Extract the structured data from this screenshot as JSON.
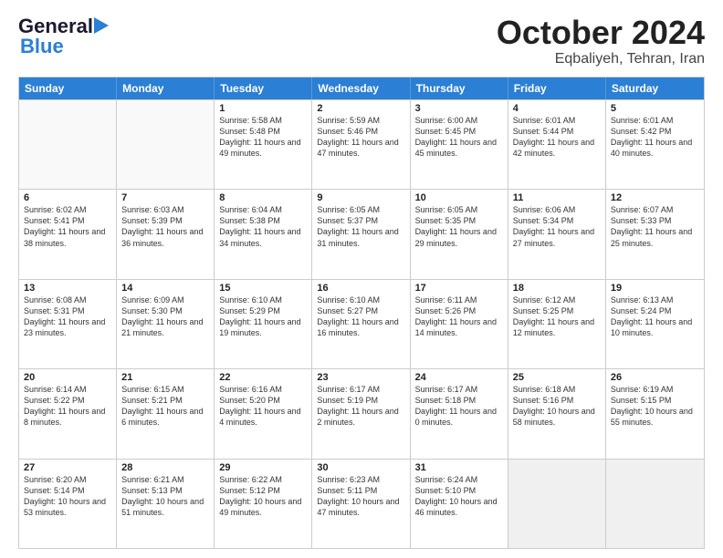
{
  "logo": {
    "general": "General",
    "blue": "Blue"
  },
  "header": {
    "month": "October 2024",
    "location": "Eqbaliyeh, Tehran, Iran"
  },
  "weekdays": [
    "Sunday",
    "Monday",
    "Tuesday",
    "Wednesday",
    "Thursday",
    "Friday",
    "Saturday"
  ],
  "rows": [
    [
      {
        "day": "",
        "info": ""
      },
      {
        "day": "",
        "info": ""
      },
      {
        "day": "1",
        "info": "Sunrise: 5:58 AM\nSunset: 5:48 PM\nDaylight: 11 hours and 49 minutes."
      },
      {
        "day": "2",
        "info": "Sunrise: 5:59 AM\nSunset: 5:46 PM\nDaylight: 11 hours and 47 minutes."
      },
      {
        "day": "3",
        "info": "Sunrise: 6:00 AM\nSunset: 5:45 PM\nDaylight: 11 hours and 45 minutes."
      },
      {
        "day": "4",
        "info": "Sunrise: 6:01 AM\nSunset: 5:44 PM\nDaylight: 11 hours and 42 minutes."
      },
      {
        "day": "5",
        "info": "Sunrise: 6:01 AM\nSunset: 5:42 PM\nDaylight: 11 hours and 40 minutes."
      }
    ],
    [
      {
        "day": "6",
        "info": "Sunrise: 6:02 AM\nSunset: 5:41 PM\nDaylight: 11 hours and 38 minutes."
      },
      {
        "day": "7",
        "info": "Sunrise: 6:03 AM\nSunset: 5:39 PM\nDaylight: 11 hours and 36 minutes."
      },
      {
        "day": "8",
        "info": "Sunrise: 6:04 AM\nSunset: 5:38 PM\nDaylight: 11 hours and 34 minutes."
      },
      {
        "day": "9",
        "info": "Sunrise: 6:05 AM\nSunset: 5:37 PM\nDaylight: 11 hours and 31 minutes."
      },
      {
        "day": "10",
        "info": "Sunrise: 6:05 AM\nSunset: 5:35 PM\nDaylight: 11 hours and 29 minutes."
      },
      {
        "day": "11",
        "info": "Sunrise: 6:06 AM\nSunset: 5:34 PM\nDaylight: 11 hours and 27 minutes."
      },
      {
        "day": "12",
        "info": "Sunrise: 6:07 AM\nSunset: 5:33 PM\nDaylight: 11 hours and 25 minutes."
      }
    ],
    [
      {
        "day": "13",
        "info": "Sunrise: 6:08 AM\nSunset: 5:31 PM\nDaylight: 11 hours and 23 minutes."
      },
      {
        "day": "14",
        "info": "Sunrise: 6:09 AM\nSunset: 5:30 PM\nDaylight: 11 hours and 21 minutes."
      },
      {
        "day": "15",
        "info": "Sunrise: 6:10 AM\nSunset: 5:29 PM\nDaylight: 11 hours and 19 minutes."
      },
      {
        "day": "16",
        "info": "Sunrise: 6:10 AM\nSunset: 5:27 PM\nDaylight: 11 hours and 16 minutes."
      },
      {
        "day": "17",
        "info": "Sunrise: 6:11 AM\nSunset: 5:26 PM\nDaylight: 11 hours and 14 minutes."
      },
      {
        "day": "18",
        "info": "Sunrise: 6:12 AM\nSunset: 5:25 PM\nDaylight: 11 hours and 12 minutes."
      },
      {
        "day": "19",
        "info": "Sunrise: 6:13 AM\nSunset: 5:24 PM\nDaylight: 11 hours and 10 minutes."
      }
    ],
    [
      {
        "day": "20",
        "info": "Sunrise: 6:14 AM\nSunset: 5:22 PM\nDaylight: 11 hours and 8 minutes."
      },
      {
        "day": "21",
        "info": "Sunrise: 6:15 AM\nSunset: 5:21 PM\nDaylight: 11 hours and 6 minutes."
      },
      {
        "day": "22",
        "info": "Sunrise: 6:16 AM\nSunset: 5:20 PM\nDaylight: 11 hours and 4 minutes."
      },
      {
        "day": "23",
        "info": "Sunrise: 6:17 AM\nSunset: 5:19 PM\nDaylight: 11 hours and 2 minutes."
      },
      {
        "day": "24",
        "info": "Sunrise: 6:17 AM\nSunset: 5:18 PM\nDaylight: 11 hours and 0 minutes."
      },
      {
        "day": "25",
        "info": "Sunrise: 6:18 AM\nSunset: 5:16 PM\nDaylight: 10 hours and 58 minutes."
      },
      {
        "day": "26",
        "info": "Sunrise: 6:19 AM\nSunset: 5:15 PM\nDaylight: 10 hours and 55 minutes."
      }
    ],
    [
      {
        "day": "27",
        "info": "Sunrise: 6:20 AM\nSunset: 5:14 PM\nDaylight: 10 hours and 53 minutes."
      },
      {
        "day": "28",
        "info": "Sunrise: 6:21 AM\nSunset: 5:13 PM\nDaylight: 10 hours and 51 minutes."
      },
      {
        "day": "29",
        "info": "Sunrise: 6:22 AM\nSunset: 5:12 PM\nDaylight: 10 hours and 49 minutes."
      },
      {
        "day": "30",
        "info": "Sunrise: 6:23 AM\nSunset: 5:11 PM\nDaylight: 10 hours and 47 minutes."
      },
      {
        "day": "31",
        "info": "Sunrise: 6:24 AM\nSunset: 5:10 PM\nDaylight: 10 hours and 46 minutes."
      },
      {
        "day": "",
        "info": ""
      },
      {
        "day": "",
        "info": ""
      }
    ]
  ]
}
